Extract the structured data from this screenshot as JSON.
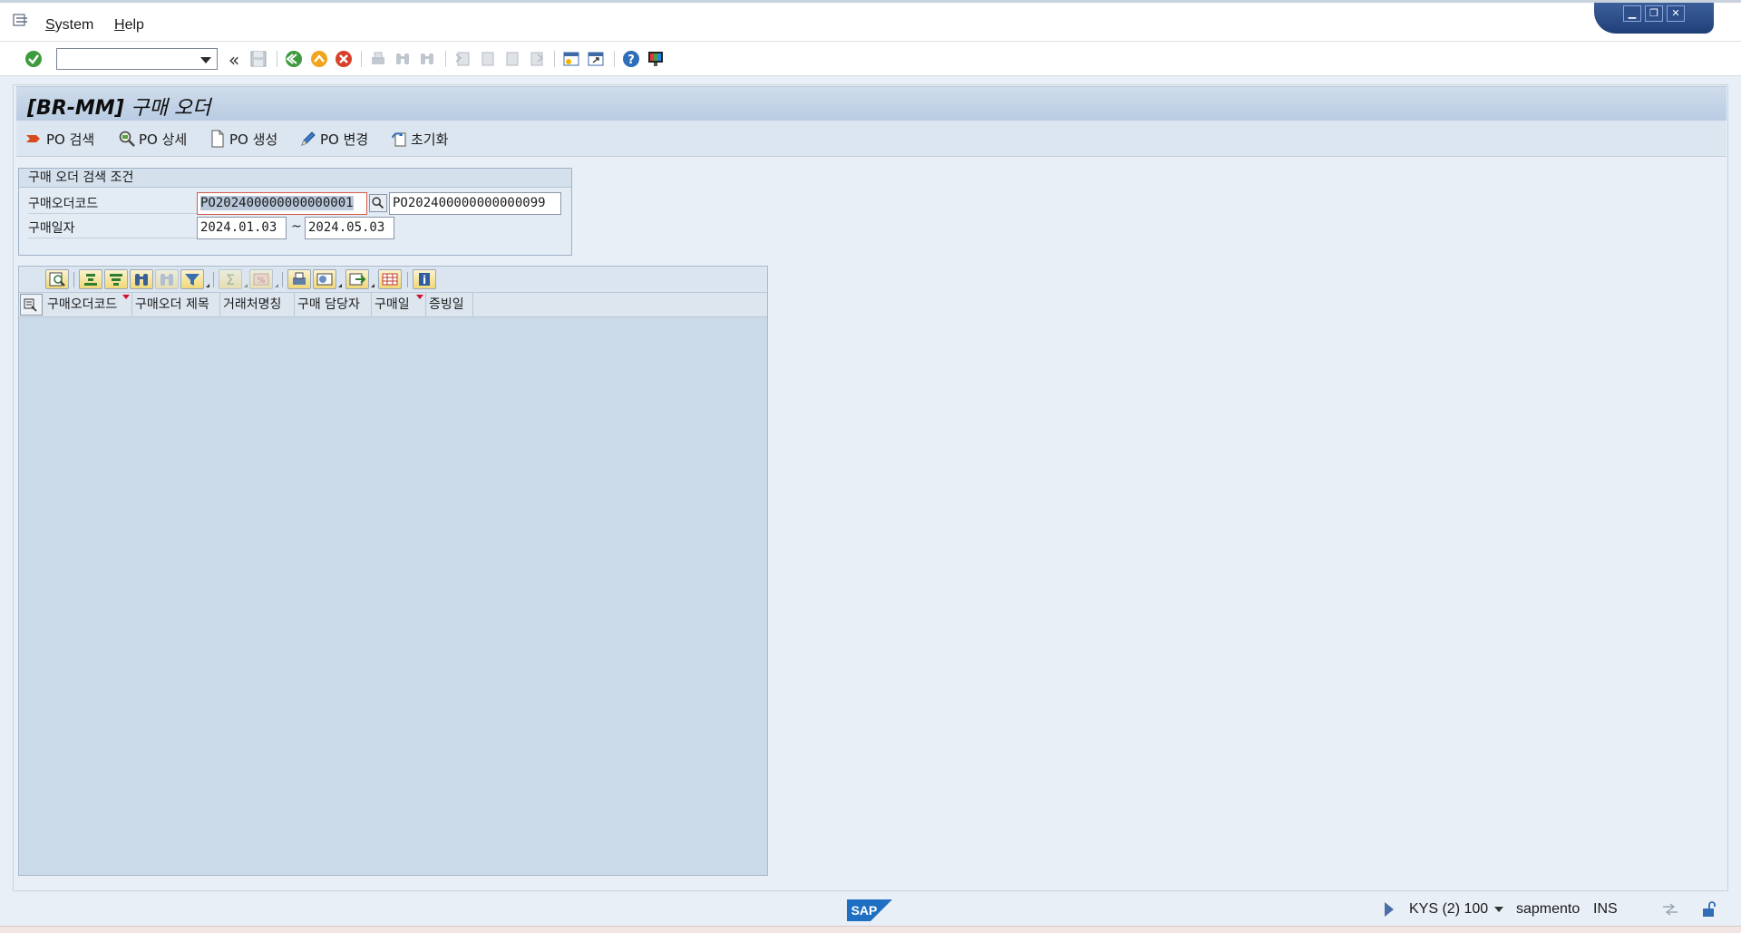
{
  "menu": {
    "items": [
      {
        "label": "System"
      },
      {
        "label": "Help"
      }
    ]
  },
  "toolbar": {
    "command_field_value": "",
    "collapse_glyph": "«",
    "icons": [
      "enter-icon",
      "save-icon",
      "back-icon",
      "exit-icon",
      "cancel-icon",
      "print-icon",
      "find-icon",
      "find-next-icon",
      "first-page-icon",
      "previous-page-icon",
      "next-page-icon",
      "last-page-icon",
      "new-session-icon",
      "shortcut-icon",
      "help-icon",
      "customize-layout-icon"
    ]
  },
  "window_controls": {
    "minimize": "▁",
    "restore": "❐",
    "close": "✕"
  },
  "title": {
    "code": "[BR-MM]",
    "text": "구매 오더"
  },
  "app_toolbar": {
    "buttons": [
      {
        "label": "PO 검색",
        "icon": "search-po-icon"
      },
      {
        "label": "PO 상세",
        "icon": "detail-icon"
      },
      {
        "label": "PO 생성",
        "icon": "create-document-icon"
      },
      {
        "label": "PO 변경",
        "icon": "edit-pencil-icon"
      },
      {
        "label": "초기화",
        "icon": "refresh-icon"
      }
    ]
  },
  "search_group": {
    "title": "구매 오더 검색 조건",
    "po_code": {
      "label": "구매오더코드",
      "from": "PO202400000000000001",
      "to": "PO202400000000000099"
    },
    "po_date": {
      "label": "구매일자",
      "from": "2024.01.03",
      "separator": "~",
      "to": "2024.05.03"
    }
  },
  "alv": {
    "toolbar_icons": [
      "details-icon",
      "sort-ascending-icon",
      "sort-descending-icon",
      "find-icon",
      "find-next-icon",
      "filter-icon",
      "sum-icon",
      "subtotal-icon",
      "print-icon",
      "views-icon",
      "export-icon",
      "layout-icon",
      "info-icon"
    ],
    "columns": [
      {
        "label": "구매오더코드",
        "sorted": true
      },
      {
        "label": "구매오더 제목",
        "sorted": false
      },
      {
        "label": "거래처명칭",
        "sorted": false
      },
      {
        "label": "구매 담당자",
        "sorted": false
      },
      {
        "label": "구매일",
        "sorted": true
      },
      {
        "label": "증빙일",
        "sorted": false
      }
    ],
    "rows": []
  },
  "status_bar": {
    "logo": "SAP",
    "system": "KYS (2) 100",
    "server": "sapmento",
    "mode": "INS"
  },
  "colors": {
    "title_bg": "#b9cce3",
    "alv_bg": "#cbdae8",
    "sap_blue": "#1e6fc2",
    "sort_marker": "#d0102e"
  }
}
